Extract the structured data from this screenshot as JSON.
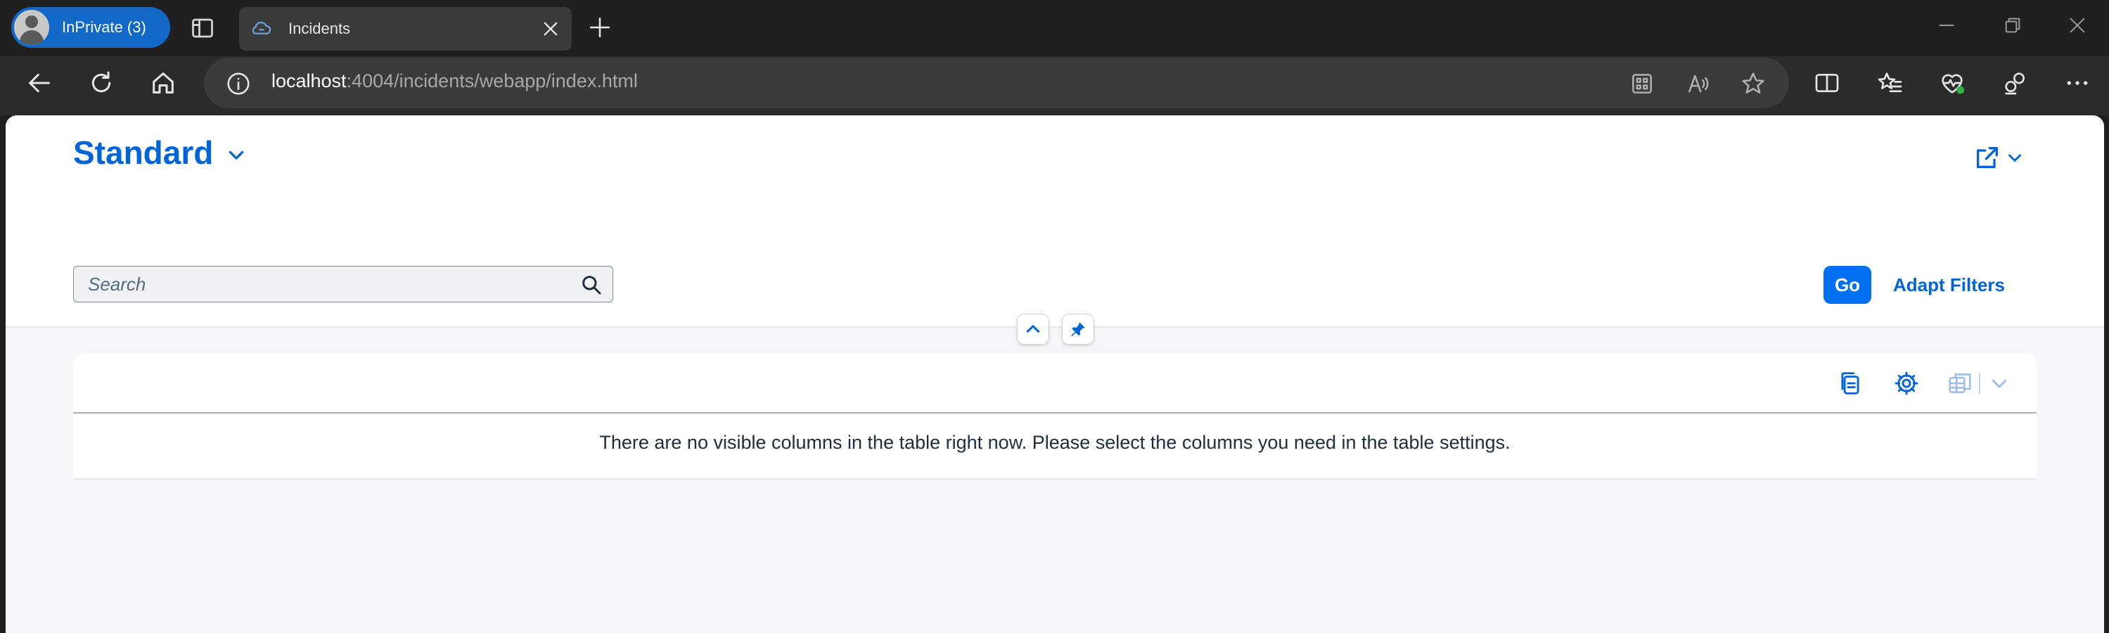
{
  "browser": {
    "profile_label": "InPrivate (3)",
    "tab_title": "Incidents",
    "url_host": "localhost",
    "url_path": ":4004/incidents/webapp/index.html"
  },
  "page": {
    "variant_title": "Standard",
    "search_placeholder": "Search",
    "go_label": "Go",
    "adapt_filters_label": "Adapt Filters",
    "empty_message": "There are no visible columns in the table right now. Please select the columns you need in the table settings."
  },
  "colors": {
    "accent": "#0064d9",
    "go_button": "#0070f2",
    "profile_pill": "#1168c6"
  }
}
